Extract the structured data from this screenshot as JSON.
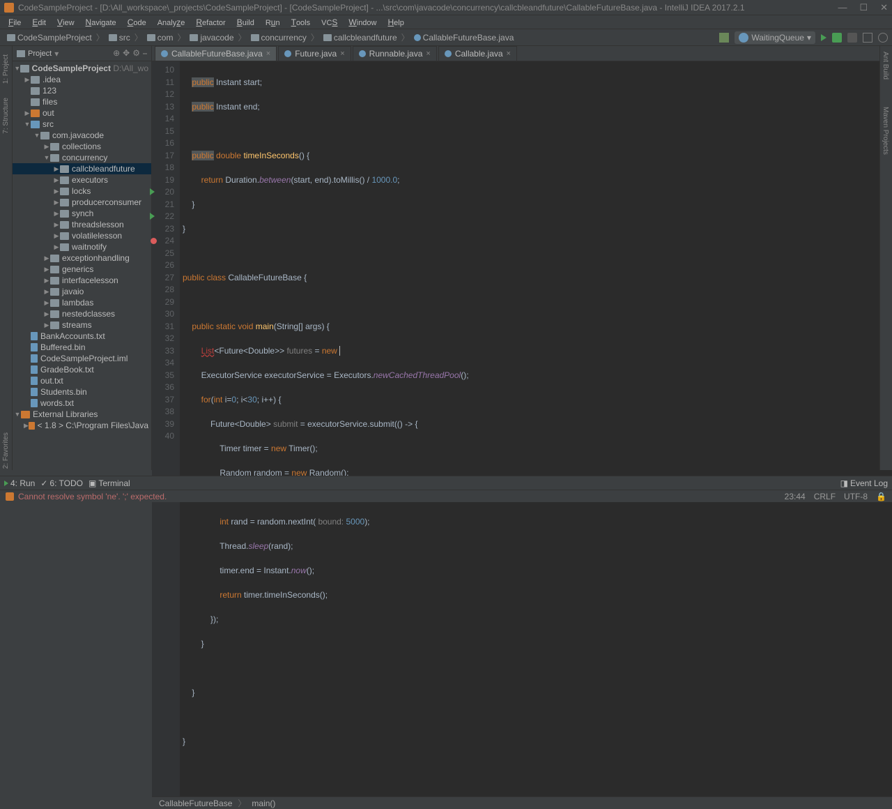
{
  "title": "CodeSampleProject - [D:\\All_workspace\\_projects\\CodeSampleProject] - [CodeSampleProject] - ...\\src\\com\\javacode\\concurrency\\callcbleandfuture\\CallableFutureBase.java - IntelliJ IDEA 2017.2.1",
  "menus": [
    "File",
    "Edit",
    "View",
    "Navigate",
    "Code",
    "Analyze",
    "Refactor",
    "Build",
    "Run",
    "Tools",
    "VCS",
    "Window",
    "Help"
  ],
  "breadcrumb": [
    "CodeSampleProject",
    "src",
    "com",
    "javacode",
    "concurrency",
    "callcbleandfuture",
    "CallableFutureBase.java"
  ],
  "runConfig": "WaitingQueue",
  "sidebar": {
    "title": "Project",
    "tree": {
      "root": "CodeSampleProject",
      "rootPath": "D:\\All_wo",
      "idea": ".idea",
      "n123": "123",
      "files": "files",
      "out": "out",
      "src": "src",
      "comjava": "com.javacode",
      "collections": "collections",
      "concurrency": "concurrency",
      "callcble": "callcbleandfuture",
      "executors": "executors",
      "locks": "locks",
      "producer": "producerconsumer",
      "synch": "synch",
      "threads": "threadslesson",
      "volatile": "volatilelesson",
      "waitnotify": "waitnotify",
      "exception": "exceptionhandling",
      "generics": "generics",
      "interface": "interfacelesson",
      "javaio": "javaio",
      "lambdas": "lambdas",
      "nested": "nestedclasses",
      "streams": "streams",
      "bank": "BankAccounts.txt",
      "buffered": "Buffered.bin",
      "iml": "CodeSampleProject.iml",
      "grade": "GradeBook.txt",
      "outtxt": "out.txt",
      "students": "Students.bin",
      "words": "words.txt",
      "extlib": "External Libraries",
      "jdk": "< 1.8 >  C:\\Program Files\\Java"
    }
  },
  "tabs": [
    {
      "label": "CallableFutureBase.java",
      "active": true
    },
    {
      "label": "Future.java",
      "active": false
    },
    {
      "label": "Runnable.java",
      "active": false
    },
    {
      "label": "Callable.java",
      "active": false
    }
  ],
  "editorCrumbs": [
    "CallableFutureBase",
    "main()"
  ],
  "bottomTabs": {
    "run": "4: Run",
    "todo": "6: TODO",
    "term": "Terminal",
    "eventlog": "Event Log"
  },
  "status": {
    "err": "Cannot resolve symbol 'ne'. ';' expected.",
    "pos": "23:44",
    "lf": "CRLF",
    "enc": "UTF-8"
  },
  "code": {
    "startLine": 10
  }
}
